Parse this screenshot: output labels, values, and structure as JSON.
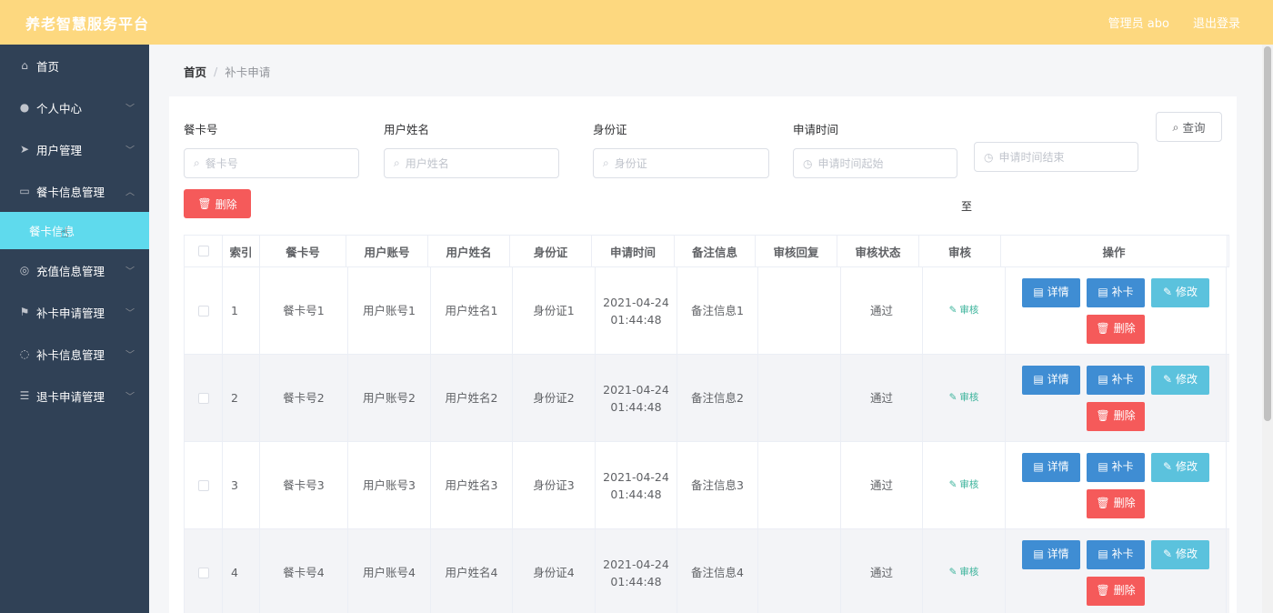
{
  "header": {
    "title": "养老智慧服务平台",
    "user": "管理员 abo",
    "logout": "退出登录"
  },
  "sidebar": {
    "items": [
      {
        "label": "首页",
        "icon": "home-icon",
        "glyph": "⌂",
        "arrow": false
      },
      {
        "label": "个人中心",
        "icon": "user-icon",
        "glyph": "●",
        "arrow": true
      },
      {
        "label": "用户管理",
        "icon": "send-icon",
        "glyph": "➤",
        "arrow": true
      },
      {
        "label": "餐卡信息管理",
        "icon": "card-icon",
        "glyph": "▭",
        "arrow": true,
        "open": true
      },
      {
        "label": "充值信息管理",
        "icon": "compass-icon",
        "glyph": "◎",
        "arrow": true
      },
      {
        "label": "补卡申请管理",
        "icon": "flag-icon",
        "glyph": "⚑",
        "arrow": true
      },
      {
        "label": "补卡信息管理",
        "icon": "aperture-icon",
        "glyph": "◌",
        "arrow": true
      },
      {
        "label": "退卡申请管理",
        "icon": "sliders-icon",
        "glyph": "☰",
        "arrow": true
      }
    ],
    "sub_item": "餐卡信息"
  },
  "breadcrumb": {
    "home": "首页",
    "sep": "/",
    "current": "补卡申请"
  },
  "filters": {
    "card_no": {
      "label": "餐卡号",
      "placeholder": "餐卡号"
    },
    "user_name": {
      "label": "用户姓名",
      "placeholder": "用户姓名"
    },
    "id_card": {
      "label": "身份证",
      "placeholder": "身份证"
    },
    "apply_time": {
      "label": "申请时间",
      "start_placeholder": "申请时间起始",
      "end_placeholder": "申请时间结束",
      "to": "至"
    },
    "query": "查询",
    "delete": "删除"
  },
  "table": {
    "headers": [
      "索引",
      "餐卡号",
      "用户账号",
      "用户姓名",
      "身份证",
      "申请时间",
      "备注信息",
      "审核回复",
      "审核状态",
      "审核",
      "操作"
    ],
    "rows": [
      {
        "index": "1",
        "card_no": "餐卡号1",
        "account": "用户账号1",
        "name": "用户姓名1",
        "id_card": "身份证1",
        "date": "2021-04-24",
        "time": "01:44:48",
        "remark": "备注信息1",
        "reply": "",
        "status": "通过"
      },
      {
        "index": "2",
        "card_no": "餐卡号2",
        "account": "用户账号2",
        "name": "用户姓名2",
        "id_card": "身份证2",
        "date": "2021-04-24",
        "time": "01:44:48",
        "remark": "备注信息2",
        "reply": "",
        "status": "通过"
      },
      {
        "index": "3",
        "card_no": "餐卡号3",
        "account": "用户账号3",
        "name": "用户姓名3",
        "id_card": "身份证3",
        "date": "2021-04-24",
        "time": "01:44:48",
        "remark": "备注信息3",
        "reply": "",
        "status": "通过"
      },
      {
        "index": "4",
        "card_no": "餐卡号4",
        "account": "用户账号4",
        "name": "用户姓名4",
        "id_card": "身份证4",
        "date": "2021-04-24",
        "time": "01:44:48",
        "remark": "备注信息4",
        "reply": "",
        "status": "通过"
      }
    ],
    "audit_label": "审核",
    "actions": {
      "detail": "详情",
      "reissue": "补卡",
      "edit": "修改",
      "delete": "删除"
    }
  }
}
